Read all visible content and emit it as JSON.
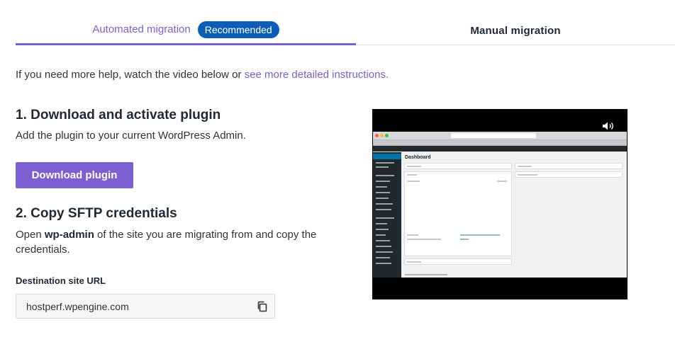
{
  "tabs": {
    "automated_label": "Automated migration",
    "recommended_badge": "Recommended",
    "manual_label": "Manual migration"
  },
  "help": {
    "text": "If you need more help, watch the video below or ",
    "link": "see more detailed instructions."
  },
  "step1": {
    "title": "1. Download and activate plugin",
    "subtitle": "Add the plugin to your current WordPress Admin.",
    "button_label": "Download plugin"
  },
  "step2": {
    "title": "2. Copy SFTP credentials",
    "text_pre": "Open ",
    "text_bold": "wp-admin",
    "text_post": " of the site you are migrating from and copy the credentials."
  },
  "destination": {
    "label": "Destination site URL",
    "value": "hostperf.wpengine.com"
  },
  "video": {
    "screen_title": "Dashboard"
  },
  "colors": {
    "accent": "#7c5fd0",
    "badge": "#0b5db8"
  }
}
